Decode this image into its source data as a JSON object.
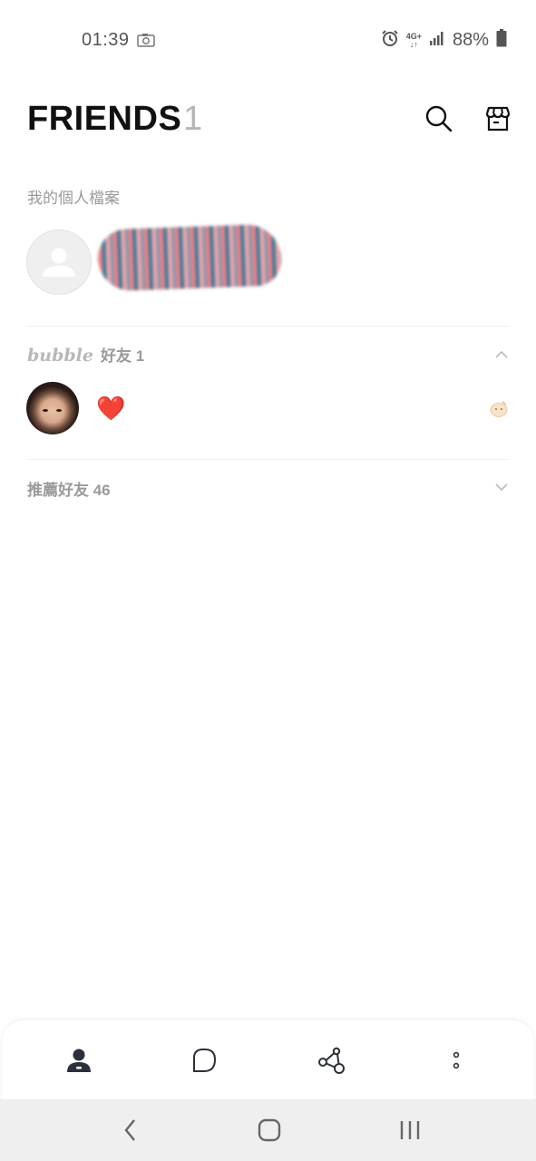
{
  "status_bar": {
    "time": "01:39",
    "network": "4G+",
    "battery": "88%"
  },
  "header": {
    "title": "FRIENDS",
    "count": "1"
  },
  "profile_section": {
    "label": "我的個人檔案"
  },
  "bubble_group": {
    "logo": "bubble",
    "label": "好友 1",
    "friends": [
      {
        "status": "❤️"
      }
    ]
  },
  "recommended_group": {
    "label": "推薦好友 46"
  },
  "bottom_nav": {
    "items": [
      "friends-icon",
      "chat-icon",
      "share-icon",
      "more-icon"
    ]
  },
  "colors": {
    "accent_dark": "#2b2f3a",
    "muted_text": "#9a9a9a",
    "heart": "#e0222e"
  }
}
